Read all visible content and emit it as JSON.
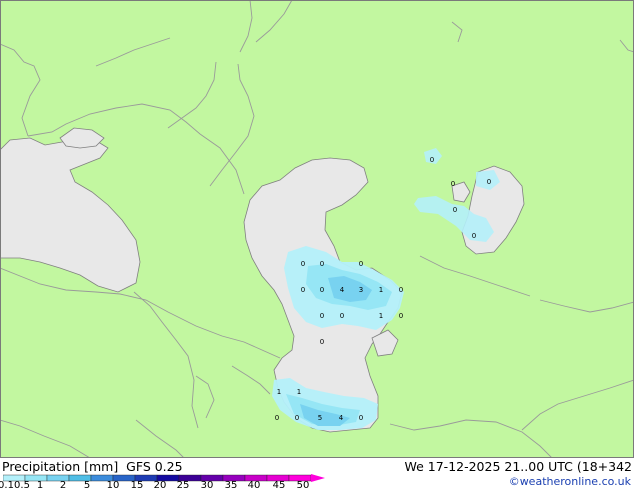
{
  "map": {
    "colors": {
      "land": "#c2f7a0",
      "sea": "#e8e8e8",
      "border": "#9a9a9a",
      "coast": "#808080"
    },
    "values": [
      {
        "label": "0"
      },
      {
        "label": "0"
      },
      {
        "label": "0"
      },
      {
        "label": "0"
      },
      {
        "label": "0"
      },
      {
        "label": "4"
      },
      {
        "label": "3"
      },
      {
        "label": "1"
      },
      {
        "label": "0"
      },
      {
        "label": "0"
      },
      {
        "label": "0"
      },
      {
        "label": "1"
      },
      {
        "label": "0"
      },
      {
        "label": "0"
      },
      {
        "label": "0"
      },
      {
        "label": "0"
      },
      {
        "label": "0"
      },
      {
        "label": "0"
      },
      {
        "label": "0"
      },
      {
        "label": "1"
      },
      {
        "label": "1"
      },
      {
        "label": "0"
      },
      {
        "label": "0"
      },
      {
        "label": "5"
      },
      {
        "label": "4"
      },
      {
        "label": "0"
      }
    ]
  },
  "legend": {
    "title": "Precipitation [mm]  GFS 0.25",
    "datetime": "We 17-12-2025 21..00 UTC (18+342",
    "credit": "©weatheronline.co.uk",
    "ticks": [
      "0.1",
      "0.5",
      "1",
      "2",
      "5",
      "10",
      "15",
      "20",
      "25",
      "30",
      "35",
      "40",
      "45",
      "50"
    ],
    "scale_colors": [
      "#b4f0fa",
      "#96e6f5",
      "#78d2f0",
      "#50bee6",
      "#3c8cdc",
      "#2864c8",
      "#1e3cb4",
      "#140aa0",
      "#3c0096",
      "#6400aa",
      "#9600be",
      "#c800c8",
      "#e600d2",
      "#ff00dc"
    ]
  }
}
